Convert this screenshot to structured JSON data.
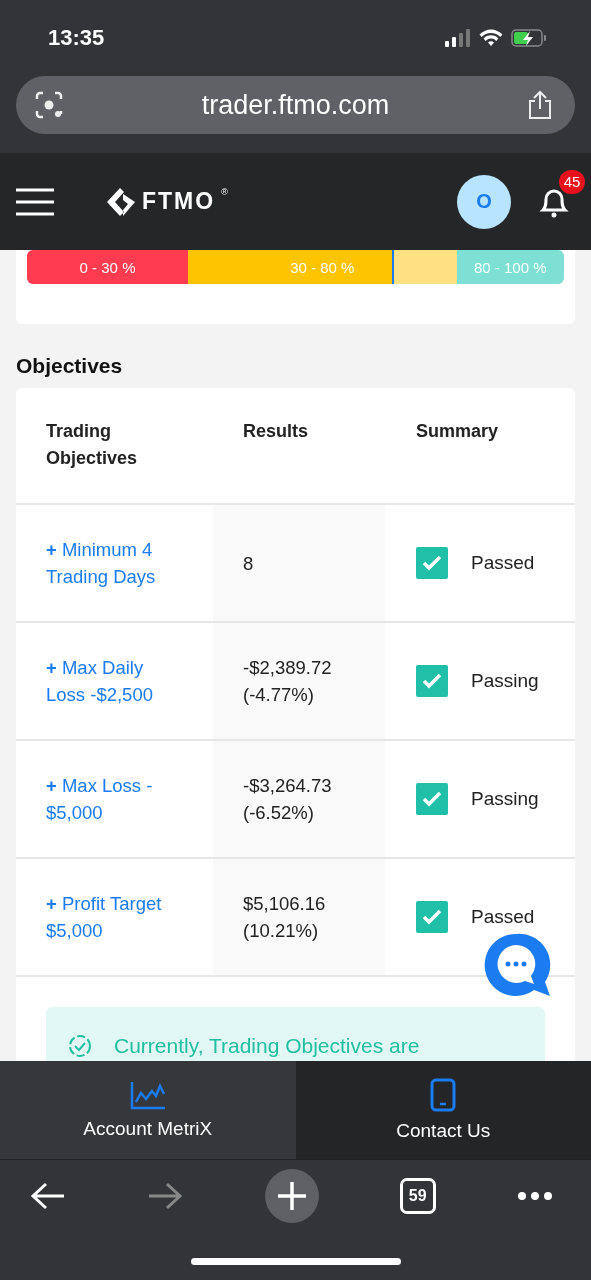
{
  "status_bar": {
    "time": "13:35"
  },
  "address_bar": {
    "url": "trader.ftmo.com"
  },
  "header": {
    "brand": "FTMO",
    "brand_mark": "®",
    "avatar": "O",
    "notifications": "45"
  },
  "gauge": {
    "level": 0.68,
    "segments": [
      {
        "label": "0 - 30 %",
        "color": "#ff3b4f"
      },
      {
        "label": "30 - 80 %",
        "color": "#ffc400"
      },
      {
        "label": "80 - 100 %",
        "color": "#7ee0d4"
      }
    ]
  },
  "objectives": {
    "title": "Objectives",
    "columns": [
      "Trading Objectives",
      "Results",
      "Summary"
    ],
    "rows": [
      {
        "objective": "**+** Minimum 4 Trading Days",
        "result": "8",
        "checked": true,
        "summary": "Passed"
      },
      {
        "objective": "**+** Max Daily Loss -$2,500",
        "result": "-$2,389.72 (-4.77%)",
        "checked": true,
        "summary": "Passing"
      },
      {
        "objective": "**+** Max Loss - $5,000",
        "result": "-$3,264.73 (-6.52%)",
        "checked": true,
        "summary": "Passing"
      },
      {
        "objective": "**+** Profit Target $5,000",
        "result": "$5,106.16 (10.21%)",
        "checked": true,
        "summary": "Passed"
      }
    ],
    "notice": "Currently, Trading Objectives are"
  },
  "bottom_tabs": [
    {
      "label": "Account MetriX",
      "kind": "chart"
    },
    {
      "label": "Contact Us",
      "kind": "phone"
    }
  ],
  "browser_bar": {
    "tab_count": "59"
  }
}
